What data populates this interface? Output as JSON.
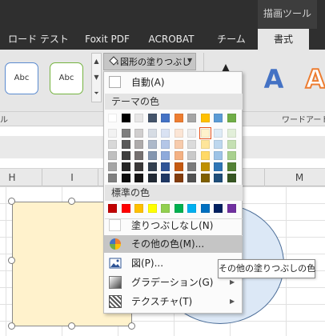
{
  "ribbon": {
    "context_title": "描画ツール",
    "tabs": [
      "ロード テスト",
      "Foxit PDF",
      "ACROBAT",
      "チーム",
      "書式"
    ],
    "active_tab": "書式",
    "shape_styles": [
      "Abc",
      "Abc"
    ],
    "fill_button_label": "図形の塗りつぶし",
    "group_left_label": "ル",
    "group_right_label": "ワードアート",
    "wordart_letters": [
      "A",
      "A",
      "A"
    ]
  },
  "grid": {
    "column_headers": [
      "H",
      "I",
      "",
      "",
      "",
      "M"
    ]
  },
  "menu": {
    "auto_label": "自動(A)",
    "theme_header": "テーマの色",
    "standard_header": "標準の色",
    "no_fill_label": "塗りつぶしなし(N)",
    "more_colors_label": "その他の色(M)...",
    "picture_label": "図(P)...",
    "gradient_label": "グラデーション(G)",
    "texture_label": "テクスチャ(T)",
    "theme_top_row": [
      "#ffffff",
      "#000000",
      "#e7e6e6",
      "#44546a",
      "#4472c4",
      "#ed7d31",
      "#a5a5a5",
      "#ffc000",
      "#5b9bd5",
      "#70ad47"
    ],
    "theme_shades": [
      [
        "#f2f2f2",
        "#7f7f7f",
        "#d0cece",
        "#d6dce4",
        "#d9e2f3",
        "#fbe5d5",
        "#ededed",
        "#fff2cc",
        "#deebf6",
        "#e2efd9"
      ],
      [
        "#d8d8d8",
        "#595959",
        "#aeabab",
        "#adb9ca",
        "#b4c6e7",
        "#f7cbac",
        "#dbdbdb",
        "#fee599",
        "#bdd7ee",
        "#c5e0b3"
      ],
      [
        "#bfbfbf",
        "#3f3f3f",
        "#757070",
        "#8496b0",
        "#8eaadb",
        "#f4b183",
        "#c9c9c9",
        "#ffd965",
        "#9dc3e6",
        "#a8d08d"
      ],
      [
        "#a5a5a5",
        "#262626",
        "#3a3838",
        "#323f4f",
        "#2f5496",
        "#c55a11",
        "#7b7b7b",
        "#bf9000",
        "#2e75b5",
        "#538135"
      ],
      [
        "#7f7f7f",
        "#0c0c0c",
        "#171616",
        "#222a35",
        "#1f3864",
        "#833c0b",
        "#525252",
        "#7f6000",
        "#1e4e79",
        "#375623"
      ]
    ],
    "standard_colors": [
      "#c00000",
      "#ff0000",
      "#ffc000",
      "#ffff00",
      "#92d050",
      "#00b050",
      "#00b0f0",
      "#0070c0",
      "#002060",
      "#7030a0"
    ],
    "selected_theme_color": "#fff2cc"
  },
  "tooltip": {
    "text": "その他の塗りつぶしの色"
  },
  "colors": {
    "ribbon_dark": "#2f2f2f",
    "ribbon_light": "#e6e6e6",
    "rect_fill": "#fff2cc",
    "circle_fill": "#dce8f6",
    "wordart_blue": "#4472c4",
    "wordart_orange": "#ed7d31"
  }
}
